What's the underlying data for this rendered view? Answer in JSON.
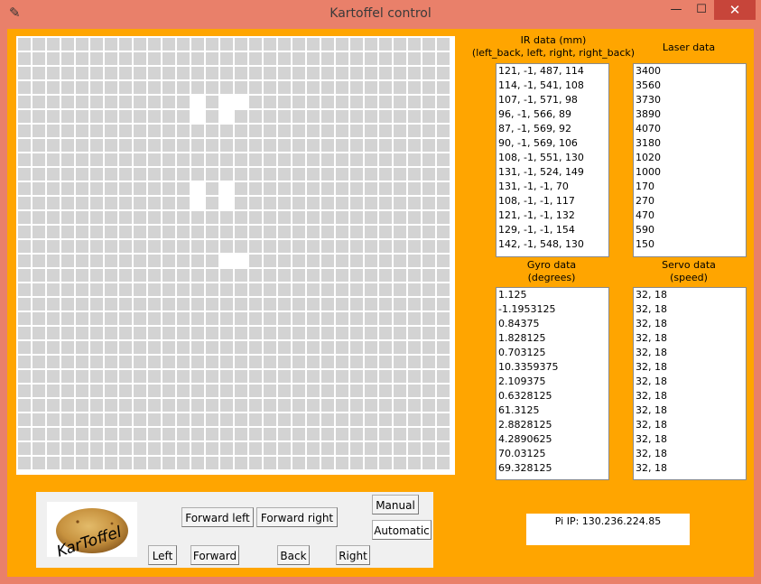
{
  "window": {
    "title": "Kartoffel control",
    "icon": "feather-icon",
    "controls": {
      "minimize": "—",
      "maximize": "☐",
      "close": "✕"
    }
  },
  "colors": {
    "client_bg": "#ffa500",
    "frame": "#e9806a",
    "grid_cell": "#d3d3d3",
    "marked_cell": "#ffffff"
  },
  "map": {
    "cols": 30,
    "rows": 30,
    "marked_cells": [
      [
        12,
        4
      ],
      [
        14,
        4
      ],
      [
        15,
        4
      ],
      [
        12,
        5
      ],
      [
        14,
        5
      ],
      [
        12,
        10
      ],
      [
        14,
        10
      ],
      [
        12,
        11
      ],
      [
        14,
        11
      ],
      [
        14,
        15
      ],
      [
        15,
        15
      ]
    ]
  },
  "ir": {
    "header_line1": "IR data (mm)",
    "header_line2": "(left_back, left, right, right_back)",
    "rows": [
      "121, -1, 487, 114",
      "114, -1, 541, 108",
      "107, -1, 571, 98",
      "96, -1, 566, 89",
      "87, -1, 569, 92",
      "90, -1, 569, 106",
      "108, -1, 551, 130",
      "131, -1, 524, 149",
      "131, -1, -1, 70",
      "108, -1, -1, 117",
      "121, -1, -1, 132",
      "129, -1, -1, 154",
      "142, -1, 548, 130"
    ]
  },
  "laser": {
    "header": "Laser data",
    "rows": [
      "3400",
      "3560",
      "3730",
      "3890",
      "4070",
      "3180",
      "1020",
      "1000",
      "170",
      "270",
      "470",
      "590",
      "150"
    ]
  },
  "gyro": {
    "header_line1": "Gyro data",
    "header_line2": "(degrees)",
    "rows": [
      "1.125",
      "-1.1953125",
      "0.84375",
      "1.828125",
      "0.703125",
      "10.3359375",
      "2.109375",
      "0.6328125",
      "61.3125",
      "2.8828125",
      "4.2890625",
      "70.03125",
      "69.328125"
    ]
  },
  "servo": {
    "header_line1": "Servo data",
    "header_line2": "(speed)",
    "rows": [
      "32, 18",
      "32, 18",
      "32, 18",
      "32, 18",
      "32, 18",
      "32, 18",
      "32, 18",
      "32, 18",
      "32, 18",
      "32, 18",
      "32, 18",
      "32, 18",
      "32, 18"
    ]
  },
  "controls": {
    "logo_text": "KarToffel",
    "forward_left": "Forward left",
    "forward_right": "Forward right",
    "left": "Left",
    "forward": "Forward",
    "back": "Back",
    "right": "Right",
    "manual": "Manual",
    "automatic": "Automatic"
  },
  "pi": {
    "ip_text": "Pi IP: 130.236.224.85"
  }
}
